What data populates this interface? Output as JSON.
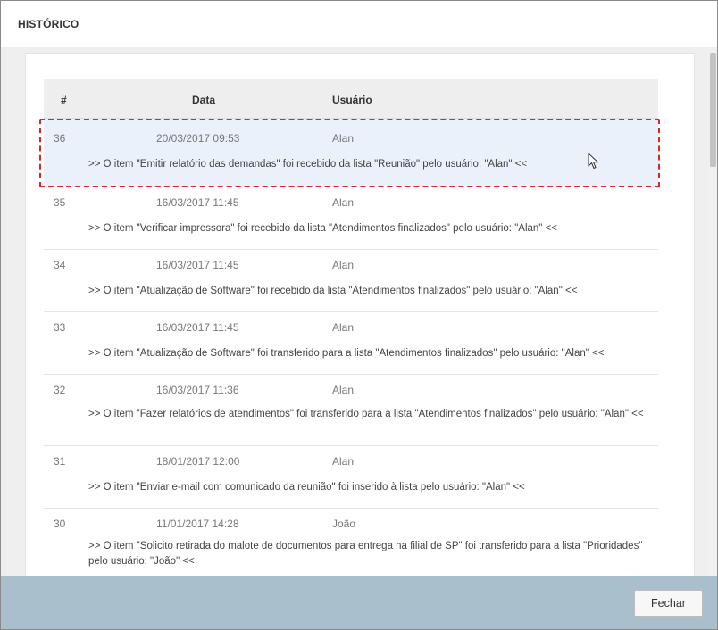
{
  "dialog": {
    "title": "HISTÓRICO"
  },
  "table": {
    "headers": {
      "num": "#",
      "date": "Data",
      "user": "Usuário"
    },
    "rows": [
      {
        "num": "36",
        "date": "20/03/2017 09:53",
        "user": "Alan",
        "message": ">> O item \"Emitir relatório das demandas\" foi recebido da lista \"Reunião\" pelo usuário:  \"Alan\" <<",
        "selected": true
      },
      {
        "num": "35",
        "date": "16/03/2017 11:45",
        "user": "Alan",
        "message": ">> O item \"Verificar impressora\" foi recebido da lista \"Atendimentos finalizados\" pelo usuário:  \"Alan\" <<"
      },
      {
        "num": "34",
        "date": "16/03/2017 11:45",
        "user": "Alan",
        "message": ">> O item \"Atualização de Software\" foi recebido da lista \"Atendimentos finalizados\" pelo usuário:  \"Alan\" <<"
      },
      {
        "num": "33",
        "date": "16/03/2017 11:45",
        "user": "Alan",
        "message": ">> O item \"Atualização de Software\" foi transferido para a lista \"Atendimentos finalizados\" pelo usuário:  \"Alan\" <<"
      },
      {
        "num": "32",
        "date": "16/03/2017 11:36",
        "user": "Alan",
        "message": ">> O item \"Fazer relatórios de atendimentos\" foi transferido para a lista \"Atendimentos finalizados\" pelo usuário:  \"Alan\" <<"
      },
      {
        "num": "31",
        "date": "18/01/2017 12:00",
        "user": "Alan",
        "message": ">> O item \"Enviar e-mail com comunicado da reunião\" foi inserido à lista pelo usuário: \"Alan\" <<"
      },
      {
        "num": "30",
        "date": "11/01/2017 14:28",
        "user": "João",
        "message": ">> O item \"Solicito retirada do malote de documentos para entrega na filial de SP\" foi transferido para a lista \"Prioridades\" pelo usuário: \"João\" <<"
      }
    ]
  },
  "footer": {
    "close_label": "Fechar"
  },
  "colors": {
    "selection_border": "#d9282a",
    "selected_row": "#eaf1fb",
    "footer": "#a9bfcc"
  }
}
